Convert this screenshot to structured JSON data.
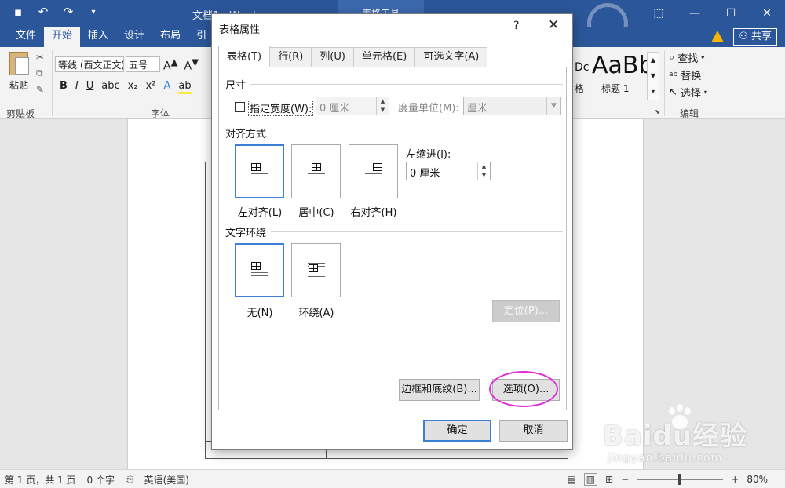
{
  "titlebar": {
    "doc_title": "文档1 - Word",
    "tool_context": "表格工具",
    "minimize": "—",
    "restore": "☐",
    "close": "✕",
    "ribbon_toggle": "⬚"
  },
  "tabs": [
    "文件",
    "开始",
    "插入",
    "设计",
    "布局",
    "引"
  ],
  "active_tab": "开始",
  "share_label": "共享",
  "ribbon": {
    "paste_label": "粘贴",
    "clipboard_group": "剪贴板",
    "font_group": "字体",
    "font_name": "等线 (西文正文)",
    "font_size": "五号",
    "style_preview": "AaBb",
    "style_name": "标题 1",
    "style_partial": "Dc",
    "edit_find": "查找",
    "edit_replace": "替换",
    "edit_select": "选择",
    "edit_group": "编辑",
    "format_buttons": [
      "B",
      "I",
      "U",
      "abc",
      "x₂",
      "x²",
      "A",
      "ab",
      "A"
    ]
  },
  "dialog": {
    "title": "表格属性",
    "help": "?",
    "close": "✕",
    "tabs": [
      "表格(T)",
      "行(R)",
      "列(U)",
      "单元格(E)",
      "可选文字(A)"
    ],
    "active_tab": "表格(T)",
    "size_section": "尺寸",
    "specify_width_label": "指定宽度(W):",
    "width_value": "0 厘米",
    "measure_label": "度量单位(M):",
    "measure_value": "厘米",
    "alignment_section": "对齐方式",
    "align_options": [
      "左对齐(L)",
      "居中(C)",
      "右对齐(H)"
    ],
    "align_selected": "左对齐(L)",
    "indent_label": "左缩进(I):",
    "indent_value": "0 厘米",
    "wrap_section": "文字环绕",
    "wrap_options": [
      "无(N)",
      "环绕(A)"
    ],
    "wrap_selected": "无(N)",
    "position_button": "定位(P)...",
    "borders_button": "边框和底纹(B)...",
    "options_button": "选项(O)...",
    "ok_button": "确定",
    "cancel_button": "取消"
  },
  "status": {
    "page": "第 1 页，共 1 页",
    "words": "0 个字",
    "language": "英语(美国)",
    "zoom": "80%",
    "zoom_fraction": 0.5
  },
  "watermark": {
    "main": "Baidu经验",
    "sub": "jingyan.baidu.com"
  },
  "colors": {
    "accent": "#2b579a",
    "selection_blue": "#3c7fd4",
    "highlight": "#e329d9"
  }
}
